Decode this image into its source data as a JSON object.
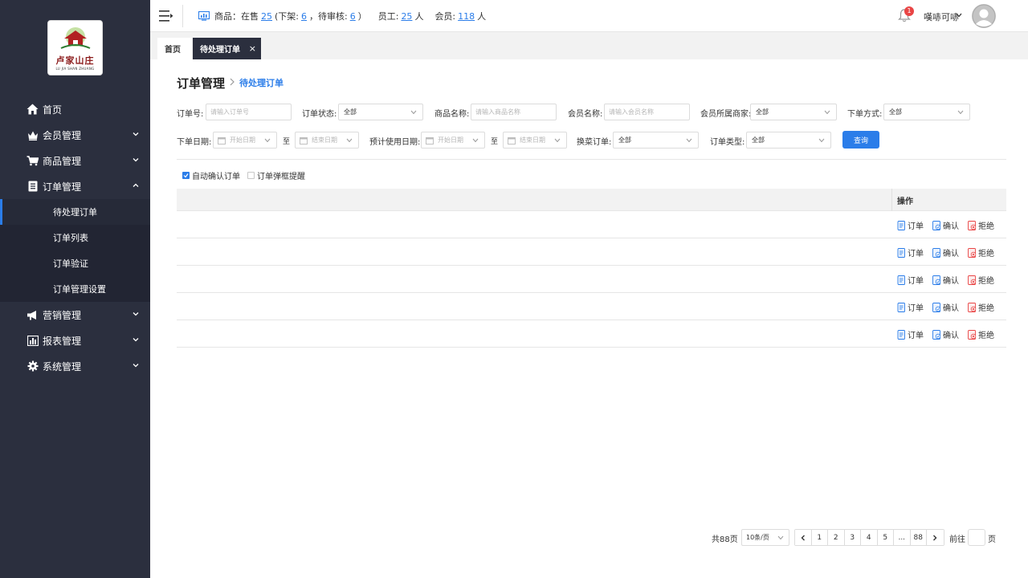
{
  "sidebar": {
    "logo": {
      "text": "卢家山庄",
      "subtext": "LU JIA SHAN ZHUANG"
    },
    "menu": [
      {
        "label": "首页",
        "icon": "home-icon"
      },
      {
        "label": "会员管理",
        "icon": "crown-icon"
      },
      {
        "label": "商品管理",
        "icon": "cart-icon"
      },
      {
        "label": "订单管理",
        "icon": "order-icon",
        "expanded": true,
        "children": [
          {
            "label": "待处理订单",
            "active": true
          },
          {
            "label": "订单列表"
          },
          {
            "label": "订单验证"
          },
          {
            "label": "订单管理设置"
          }
        ]
      },
      {
        "label": "营销管理",
        "icon": "megaphone-icon"
      },
      {
        "label": "报表管理",
        "icon": "bar-chart-icon"
      },
      {
        "label": "系统管理",
        "icon": "gear-icon"
      }
    ]
  },
  "topbar": {
    "stats": {
      "goods_label": "商品：在售",
      "on_sale": "25",
      "off_shelf_label": "(下架:",
      "off_shelf": "6",
      "pending_label": "，待审核:",
      "pending": "6",
      "close_paren": "）",
      "staff_label": "员工:",
      "staff": "25",
      "staff_unit": "人",
      "members_label": "会员:",
      "members": "118",
      "members_unit": "人"
    },
    "notification_count": "1",
    "user_name": "嘆哧可哧"
  },
  "tabs": {
    "home": "首页",
    "current": "待处理订单",
    "close": "×"
  },
  "page": {
    "title": "订单管理",
    "breadcrumb_current": "待处理订单"
  },
  "filters": {
    "order_no": {
      "label": "订单号:",
      "placeholder": "请输入订单号"
    },
    "order_status": {
      "label": "订单状态:",
      "value": "全部"
    },
    "goods_name": {
      "label": "商品名称:",
      "placeholder": "请输入商品名称"
    },
    "member_name": {
      "label": "会员名称:",
      "placeholder": "请输入会员名称"
    },
    "merchant": {
      "label": "会员所属商家:",
      "value": "全部"
    },
    "order_method": {
      "label": "下单方式:",
      "value": "全部"
    },
    "order_date": {
      "label": "下单日期:",
      "start": "开始日期",
      "end": "结束日期"
    },
    "use_date": {
      "label": "预计使用日期:",
      "start": "开始日期",
      "end": "结束日期"
    },
    "to": "至",
    "exchange": {
      "label": "换菜订单:",
      "value": "全部"
    },
    "order_type": {
      "label": "订单类型:",
      "value": "全部"
    },
    "query_button": "查询"
  },
  "options": {
    "auto_confirm": {
      "label": "自动确认订单",
      "checked": true
    },
    "popup_reminder": {
      "label": "订单弹框提醒",
      "checked": false
    }
  },
  "table": {
    "op_header": "操作",
    "rows": [
      {
        "actions": [
          "订单",
          "确认",
          "拒绝"
        ]
      },
      {
        "actions": [
          "订单",
          "确认",
          "拒绝"
        ]
      },
      {
        "actions": [
          "订单",
          "确认",
          "拒绝"
        ]
      },
      {
        "actions": [
          "订单",
          "确认",
          "拒绝"
        ]
      },
      {
        "actions": [
          "订单",
          "确认",
          "拒绝"
        ]
      }
    ]
  },
  "pagination": {
    "total": "共88页",
    "page_size": "10条/页",
    "pages": [
      "1",
      "2",
      "3",
      "4",
      "5",
      "...",
      "88"
    ],
    "goto_label": "前往",
    "page_label": "页"
  },
  "colors": {
    "sidebar_bg": "#2b2f3e",
    "accent": "#2b7de9",
    "badge": "#e94545"
  }
}
